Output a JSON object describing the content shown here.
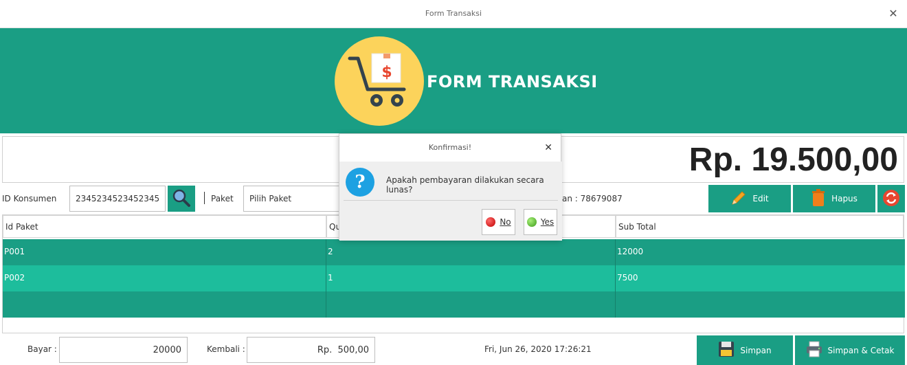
{
  "window": {
    "title": "Form Transaksi"
  },
  "header": {
    "title": "FORM TRANSAKSI"
  },
  "total": {
    "amount": "Rp. 19.500,00"
  },
  "form": {
    "id_konsumen_label": "ID Konsumen",
    "id_konsumen_value": "2345234523452345",
    "paket_label": "Paket",
    "paket_value": "Pilih Paket",
    "partial_label": "an : 78679087"
  },
  "actions": {
    "edit": "Edit",
    "hapus": "Hapus"
  },
  "table": {
    "headers": [
      "Id Paket",
      "Qu",
      "Sub Total"
    ],
    "rows": [
      [
        "P001",
        "2",
        "12000"
      ],
      [
        "P002",
        "1",
        "7500"
      ],
      [
        "",
        "",
        ""
      ]
    ]
  },
  "footer": {
    "bayar_label": "Bayar :",
    "bayar_value": "20000",
    "kembali_label": "Kembali :",
    "kembali_value": "Rp.  500,00",
    "datetime": "Fri, Jun 26, 2020 17:26:21",
    "simpan": "Simpan",
    "simpan_cetak": "Simpan & Cetak"
  },
  "dialog": {
    "title": "Konfirmasi!",
    "message": "Apakah pembayaran dilakukan secara lunas?",
    "no": "No",
    "yes": "Yes"
  },
  "colors": {
    "accent": "#1a9e84",
    "row_alt": "#1dbd9c",
    "logo": "#fcd35b",
    "info": "#1da1e2"
  }
}
